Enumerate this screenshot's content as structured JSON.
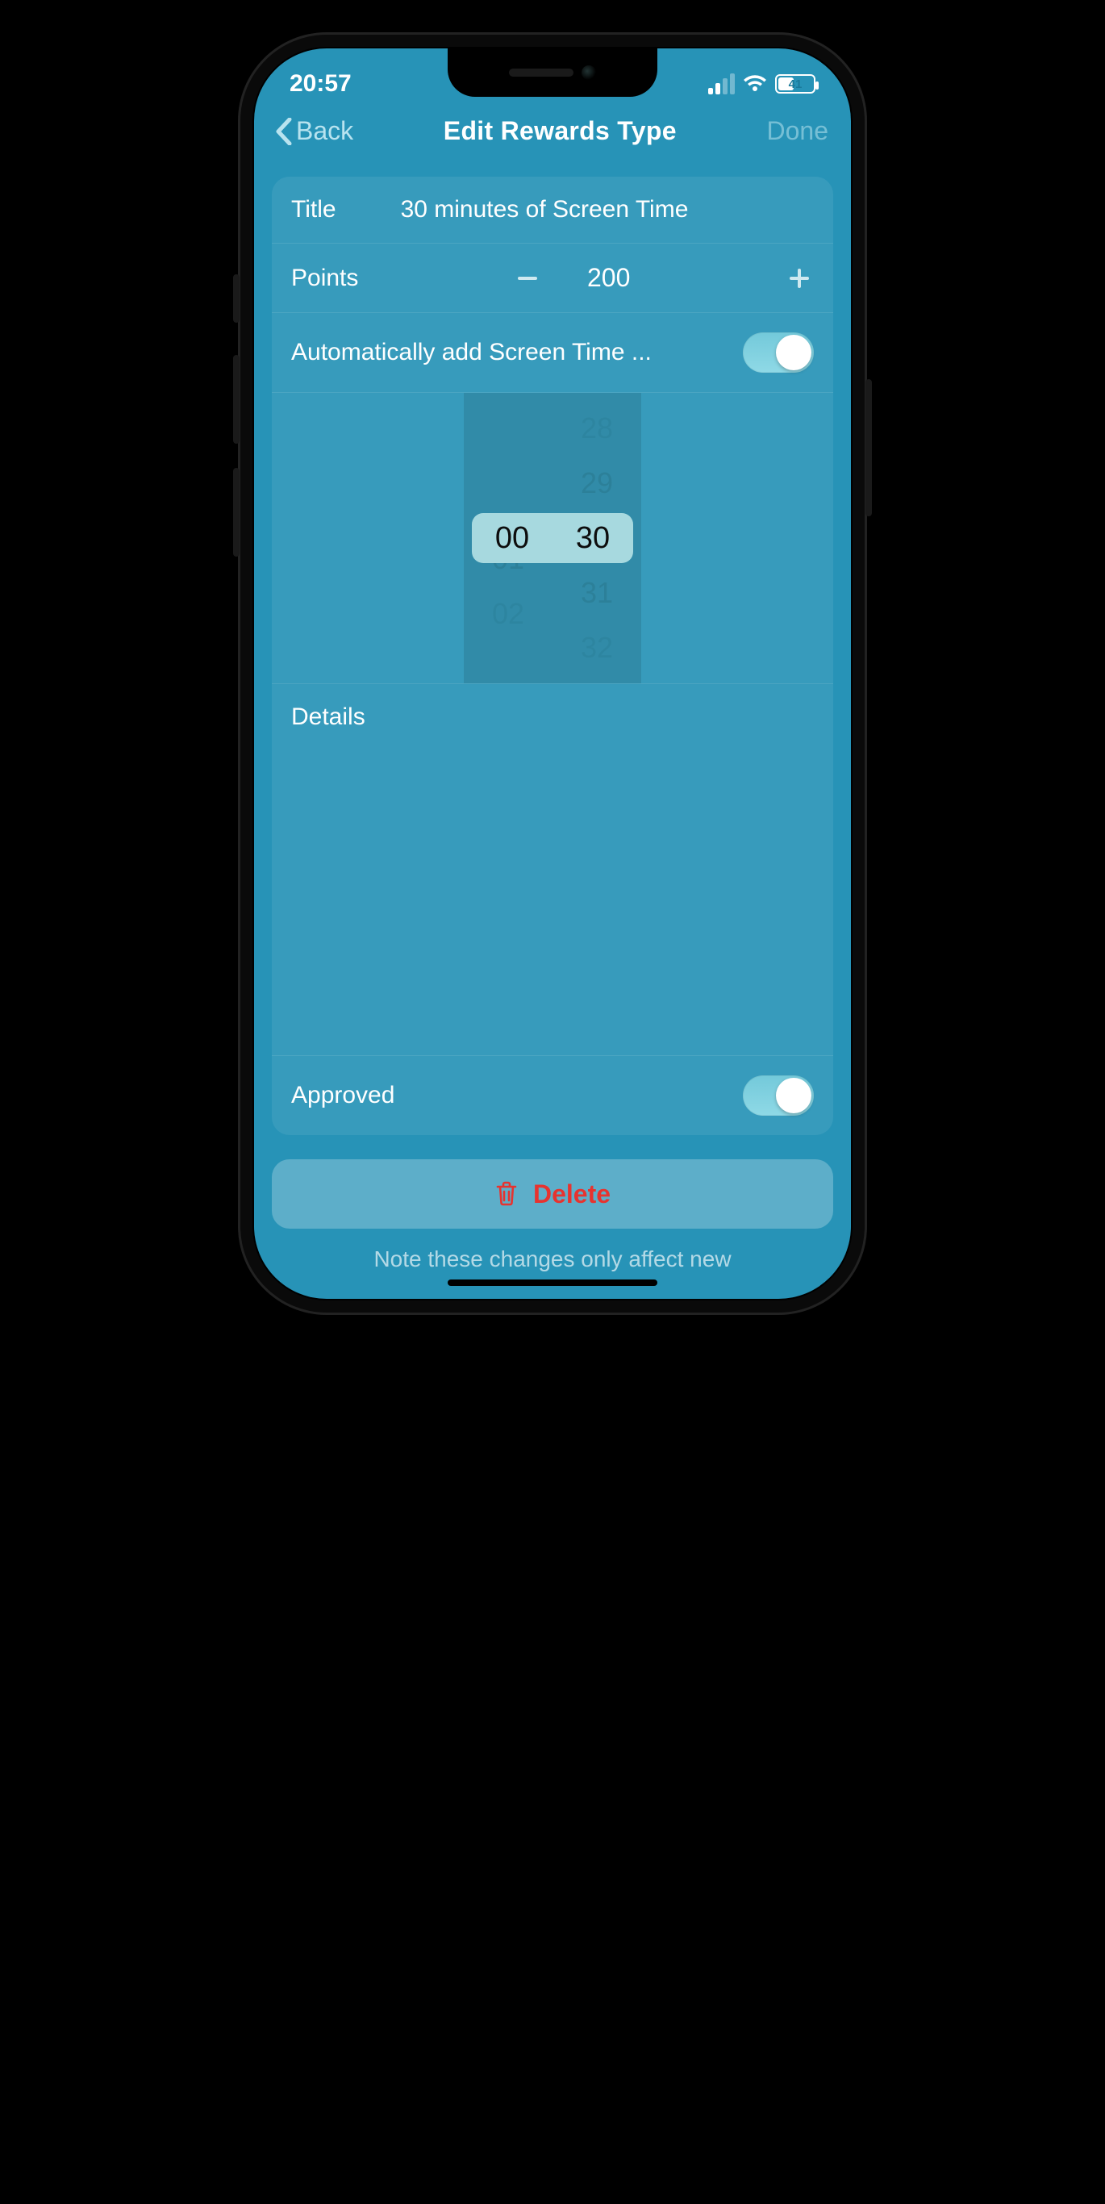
{
  "status": {
    "time": "20:57",
    "battery_pct": "41"
  },
  "nav": {
    "back_label": "Back",
    "title": "Edit Rewards Type",
    "done_label": "Done"
  },
  "row_title": {
    "label": "Title",
    "value": "30 minutes of Screen Time"
  },
  "row_points": {
    "label": "Points",
    "value": "200"
  },
  "row_auto": {
    "label": "Automatically add Screen Time ...",
    "on": true
  },
  "picker": {
    "left_above2": "",
    "left_above": "",
    "left_sel": "00",
    "left_below": "01",
    "left_below2": "02",
    "right_above2": "28",
    "right_above": "29",
    "right_sel": "30",
    "right_below": "31",
    "right_below2": "32"
  },
  "row_details": {
    "label": "Details"
  },
  "row_approved": {
    "label": "Approved"
  },
  "delete": {
    "label": "Delete"
  },
  "footer": {
    "note": "Note these changes only affect new"
  }
}
